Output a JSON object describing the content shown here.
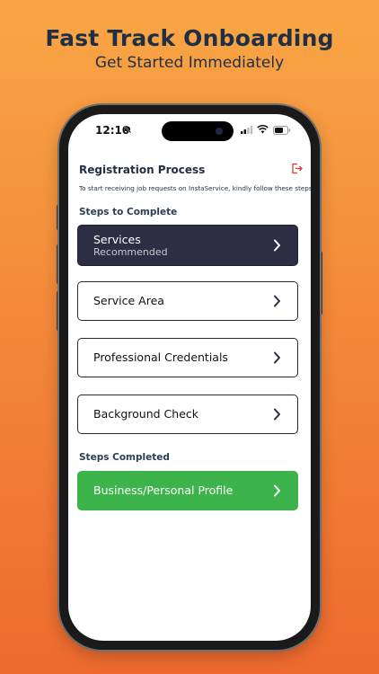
{
  "promo": {
    "headline": "Fast Track Onboarding",
    "subheadline": "Get Started Immediately"
  },
  "status_bar": {
    "time": "12:10",
    "icons": [
      "bell-slash-icon",
      "signal-icon",
      "wifi-icon",
      "battery-icon"
    ]
  },
  "header": {
    "title": "Registration Process",
    "logout_icon": "logout-icon"
  },
  "instructions": "To start receiving job requests on InstaService, kindly follow these steps",
  "steps_to_complete": {
    "heading": "Steps to Complete",
    "items": [
      {
        "label": "Services",
        "sublabel": "Recommended"
      },
      {
        "label": "Service Area"
      },
      {
        "label": "Professional Credentials"
      },
      {
        "label": "Background Check"
      }
    ]
  },
  "steps_completed": {
    "heading": "Steps Completed",
    "items": [
      {
        "label": "Business/Personal Profile"
      }
    ]
  },
  "colors": {
    "background_top": "#f8a645",
    "background_bottom": "#ee6a2e",
    "heading_text": "#1f2f44",
    "recommended_card": "#2d2e43",
    "completed_card": "#3db34b",
    "logout_icon": "#e53935"
  }
}
